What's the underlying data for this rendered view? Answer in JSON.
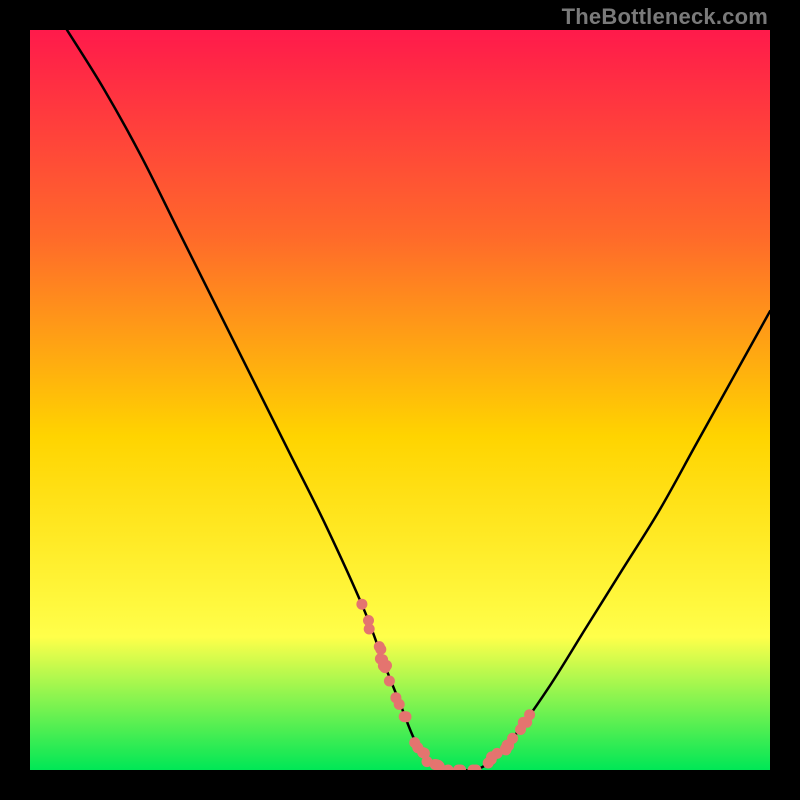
{
  "watermark": "TheBottleneck.com",
  "colors": {
    "gradient_top": "#ff1a4b",
    "gradient_mid1": "#ff6a2a",
    "gradient_mid2": "#ffd400",
    "gradient_mid3": "#ffff4a",
    "gradient_bottom": "#00e756",
    "curve": "#000000",
    "dots": "#e4746f",
    "plot_border": "#000000"
  },
  "chart_data": {
    "type": "line",
    "title": "",
    "xlabel": "",
    "ylabel": "",
    "xlim": [
      0,
      100
    ],
    "ylim": [
      0,
      100
    ],
    "x": [
      5,
      10,
      15,
      20,
      25,
      30,
      35,
      40,
      45,
      48,
      50,
      52,
      54,
      56,
      58,
      60,
      62,
      65,
      70,
      75,
      80,
      85,
      90,
      95,
      100
    ],
    "values": [
      100,
      92,
      83,
      73,
      63,
      53,
      43,
      33,
      22,
      14,
      9,
      4,
      1,
      0,
      0,
      0,
      1,
      4,
      11,
      19,
      27,
      35,
      44,
      53,
      62
    ],
    "dots_left": {
      "x_range": [
        42,
        50
      ],
      "y_range": [
        3,
        28
      ]
    },
    "dots_floor": {
      "x_range": [
        50,
        62
      ],
      "y_range": [
        0,
        3
      ]
    },
    "dots_right": {
      "x_range": [
        62,
        68
      ],
      "y_range": [
        3,
        28
      ]
    }
  }
}
